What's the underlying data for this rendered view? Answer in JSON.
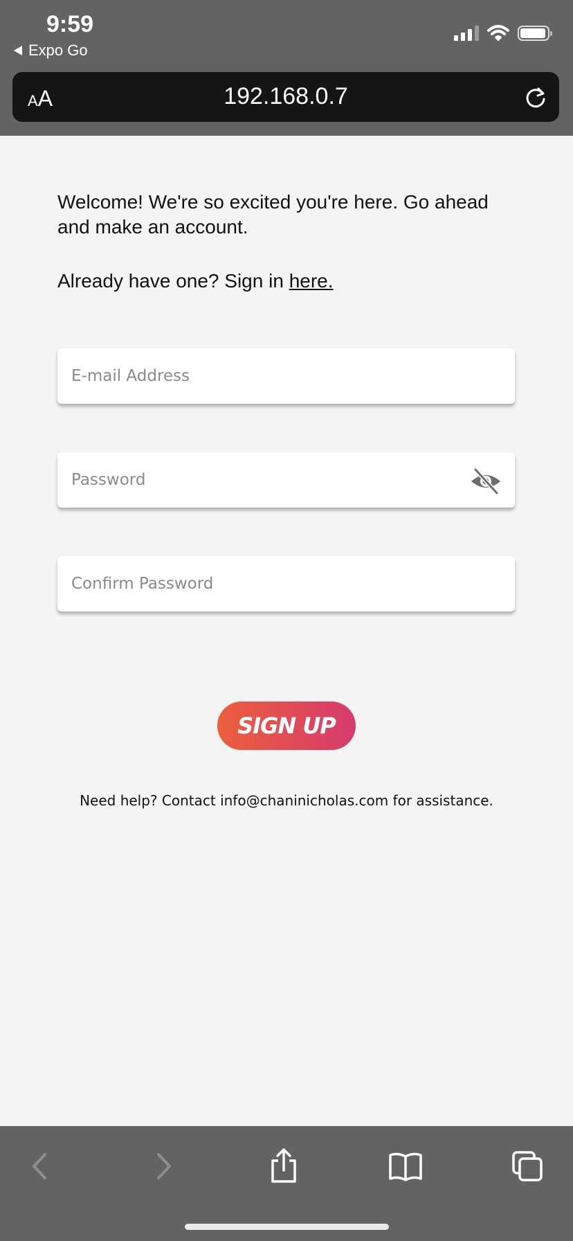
{
  "status_bar": {
    "time": "9:59",
    "back_app": "Expo Go"
  },
  "browser": {
    "text_size_small": "A",
    "text_size_large": "A",
    "url": "192.168.0.7"
  },
  "content": {
    "welcome_text": "Welcome! We're so excited you're here. Go ahead and make an account.",
    "signin_prefix": "Already have one? Sign in ",
    "signin_link": "here."
  },
  "form": {
    "email_placeholder": "E-mail Address",
    "password_placeholder": "Password",
    "confirm_placeholder": "Confirm Password",
    "signup_label": "SIGN UP"
  },
  "footer": {
    "help_text": "Need help? Contact info@chaninicholas.com for assistance."
  },
  "icons": {
    "eye": "eye-off-icon",
    "reload": "reload-icon",
    "back": "chevron-left-icon",
    "forward": "chevron-right-icon",
    "share": "share-icon",
    "bookmarks": "book-icon",
    "tabs": "tabs-icon"
  },
  "colors": {
    "chrome": "#636363",
    "url_bar": "#151515",
    "page_bg": "#f4f4f4",
    "button_start": "#ec5f3c",
    "button_end": "#d63b6e"
  }
}
